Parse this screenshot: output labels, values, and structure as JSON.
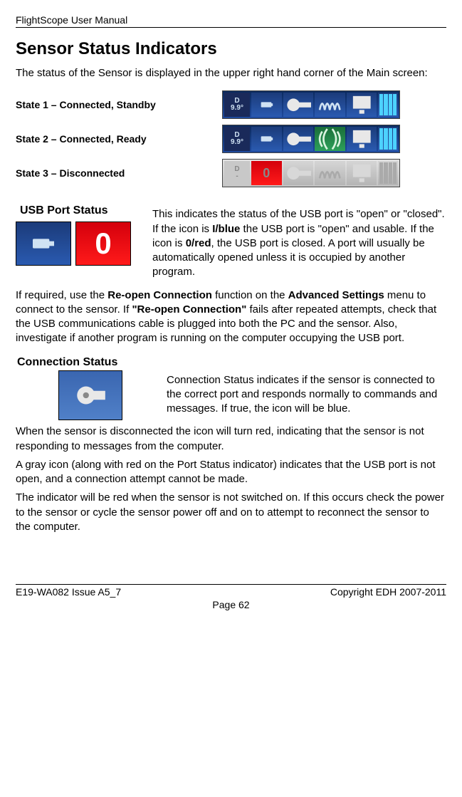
{
  "header": {
    "title": "FlightScope User Manual"
  },
  "heading": "Sensor Status Indicators",
  "intro": "The status of the Sensor is displayed in the upper right hand corner of the Main screen:",
  "states": [
    {
      "label": "State 1 – Connected, Standby",
      "angle_top": "D",
      "angle_bottom": "9.9°",
      "red_zero": false,
      "gray": false
    },
    {
      "label": "State 2 – Connected, Ready",
      "angle_top": "D",
      "angle_bottom": "9.9°",
      "red_zero": false,
      "gray": false
    },
    {
      "label": "State 3 – Disconnected",
      "angle_top": "D",
      "angle_bottom": "-",
      "red_zero": true,
      "gray": true
    }
  ],
  "usb": {
    "title": "USB Port Status",
    "red_label": "0",
    "text_parts": [
      "This indicates the status of the USB port is \"open\" or \"closed\". If the icon is ",
      "I/blue",
      " the USB port is \"open\" and usable. If the icon is ",
      "0/red",
      ", the USB port is closed.  A port will usually be automatically opened unless it is occupied by another program."
    ]
  },
  "reopen_parts": [
    "If required, use the ",
    "Re-open Connection",
    " function on the ",
    "Advanced Settings",
    " menu to connect to the sensor. If ",
    "\"Re-open Connection\"",
    " fails after repeated attempts, check that the USB communications cable is plugged into both the PC and the sensor. Also, investigate if another program is running on the computer occupying the USB port."
  ],
  "connection": {
    "title": "Connection Status",
    "text": "Connection Status indicates if the sensor is connected to the correct port and responds normally to commands and messages. If true, the icon will be blue."
  },
  "conn_para2": "When the sensor is disconnected the icon will turn red, indicating that the sensor is not responding to messages from the computer.",
  "conn_para3": "A gray icon (along with red on the Port Status indicator) indicates that the USB port is not open, and a connection attempt cannot be made.",
  "conn_para4": "The indicator will be red when the sensor is not switched on. If this occurs check the power to the sensor or cycle the sensor power off and on to attempt to reconnect the sensor to the computer.",
  "footer": {
    "left": "E19-WA082 Issue A5_7",
    "right": "Copyright EDH 2007-2011",
    "page": "Page 62"
  }
}
